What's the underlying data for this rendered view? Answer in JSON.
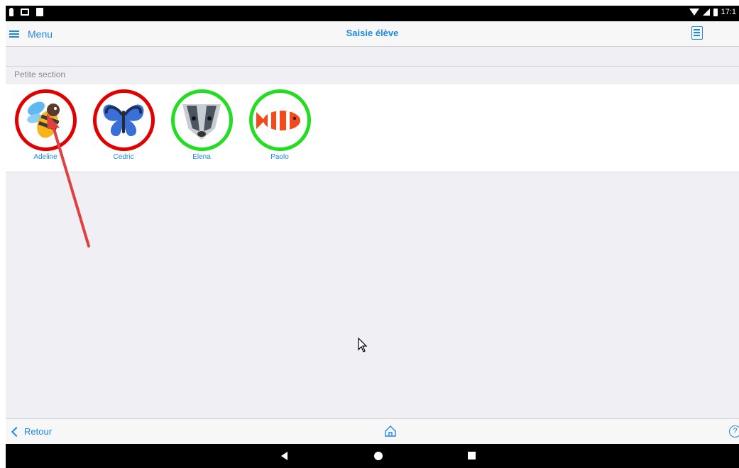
{
  "statusbar": {
    "time": "17:1"
  },
  "navbar": {
    "menu_label": "Menu",
    "title": "Saisie élève"
  },
  "section": {
    "header": "Petite section"
  },
  "students": [
    {
      "name": "Adeline",
      "animal": "bee-icon",
      "ring_color": "#e00000"
    },
    {
      "name": "Cedric",
      "animal": "butterfly-icon",
      "ring_color": "#e00000"
    },
    {
      "name": "Elena",
      "animal": "badger-icon",
      "ring_color": "#22dd22"
    },
    {
      "name": "Paolo",
      "animal": "clownfish-icon",
      "ring_color": "#22dd22"
    }
  ],
  "bottombar": {
    "back_label": "Retour",
    "help_label": "?"
  },
  "colors": {
    "accent": "#1e88e5",
    "absent": "#e00000",
    "present": "#22dd22",
    "annotation": "#e04040"
  }
}
